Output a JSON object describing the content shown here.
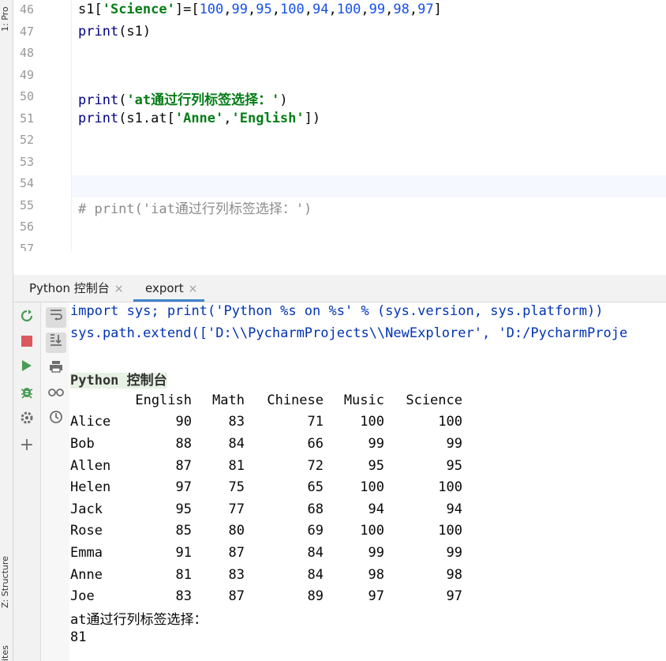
{
  "left_strip": {
    "top_tab": "1: Pro",
    "structure_tab": "Z: Structure",
    "favorites_tab": "ites"
  },
  "editor": {
    "lines": [
      {
        "no": "46",
        "parts": [
          [
            "s1[",
            ""
          ],
          [
            "'Science'",
            "str"
          ],
          [
            "]=[",
            ""
          ],
          [
            "100",
            "num"
          ],
          [
            ",",
            ""
          ],
          [
            "99",
            "num"
          ],
          [
            ",",
            ""
          ],
          [
            "95",
            "num"
          ],
          [
            ",",
            ""
          ],
          [
            "100",
            "num"
          ],
          [
            ",",
            ""
          ],
          [
            "94",
            "num"
          ],
          [
            ",",
            ""
          ],
          [
            "100",
            "num"
          ],
          [
            ",",
            ""
          ],
          [
            "99",
            "num"
          ],
          [
            ",",
            ""
          ],
          [
            "98",
            "num"
          ],
          [
            ",",
            ""
          ],
          [
            "97",
            "num"
          ],
          [
            "]",
            ""
          ]
        ]
      },
      {
        "no": "47",
        "parts": [
          [
            "print",
            "kw"
          ],
          [
            "(s1)",
            ""
          ]
        ]
      },
      {
        "no": "48",
        "parts": []
      },
      {
        "no": "49",
        "parts": []
      },
      {
        "no": "50",
        "parts": [
          [
            "print",
            "kw"
          ],
          [
            "(",
            ""
          ],
          [
            "'at通过行列标签选择：'",
            "str"
          ],
          [
            ")",
            ""
          ]
        ]
      },
      {
        "no": "51",
        "parts": [
          [
            "print",
            "kw"
          ],
          [
            "(s1.at[",
            ""
          ],
          [
            "'Anne'",
            "str"
          ],
          [
            ",",
            ""
          ],
          [
            "'English'",
            "str"
          ],
          [
            "])",
            ""
          ]
        ]
      },
      {
        "no": "52",
        "parts": []
      },
      {
        "no": "53",
        "parts": []
      },
      {
        "no": "54",
        "parts": []
      },
      {
        "no": "55",
        "parts": [
          [
            "# print('iat通过行列标签选择：')",
            "cmt"
          ]
        ]
      },
      {
        "no": "56",
        "parts": []
      },
      {
        "no": "57",
        "parts": []
      }
    ]
  },
  "tabs": [
    {
      "label": "Python 控制台",
      "close": "×"
    },
    {
      "label": "export",
      "close": "×"
    }
  ],
  "console": {
    "line1_blue": "import sys; print('Python %s on %s' % (sys.version, sys.platform))",
    "line2_blue": "sys.path.extend(['D:\\\\PycharmProjects\\\\NewExplorer', 'D:/PycharmProje",
    "banner": "Python 控制台",
    "table": {
      "columns": [
        "English",
        "Math",
        "Chinese",
        "Music",
        "Science"
      ],
      "rows": [
        {
          "name": "Alice",
          "values": [
            "90",
            "83",
            "71",
            "100",
            "100"
          ]
        },
        {
          "name": "Bob",
          "values": [
            "88",
            "84",
            "66",
            "99",
            "99"
          ]
        },
        {
          "name": "Allen",
          "values": [
            "87",
            "81",
            "72",
            "95",
            "95"
          ]
        },
        {
          "name": "Helen",
          "values": [
            "97",
            "75",
            "65",
            "100",
            "100"
          ]
        },
        {
          "name": "Jack",
          "values": [
            "95",
            "77",
            "68",
            "94",
            "94"
          ]
        },
        {
          "name": "Rose",
          "values": [
            "85",
            "80",
            "69",
            "100",
            "100"
          ]
        },
        {
          "name": "Emma",
          "values": [
            "91",
            "87",
            "84",
            "99",
            "99"
          ]
        },
        {
          "name": "Anne",
          "values": [
            "81",
            "83",
            "84",
            "98",
            "98"
          ]
        },
        {
          "name": "Joe",
          "values": [
            "83",
            "87",
            "89",
            "97",
            "97"
          ]
        }
      ]
    },
    "after_text": "at通过行列标签选择：",
    "result": "81"
  },
  "icons": {
    "rerun": "rerun-icon",
    "stop": "stop-icon",
    "run": "run-icon",
    "debug": "debug-icon",
    "settings": "gear-icon",
    "add": "plus-icon",
    "soft_wrap": "soft-wrap-icon",
    "scroll_end": "scroll-to-end-icon",
    "print": "print-icon",
    "view_vars": "glasses-icon",
    "history": "history-icon"
  },
  "colors": {
    "string": "#067d17",
    "number": "#1750eb",
    "keyword": "#000080",
    "tab_accent": "#4083c9",
    "run_green": "#499c54",
    "stop_red": "#db5860"
  }
}
